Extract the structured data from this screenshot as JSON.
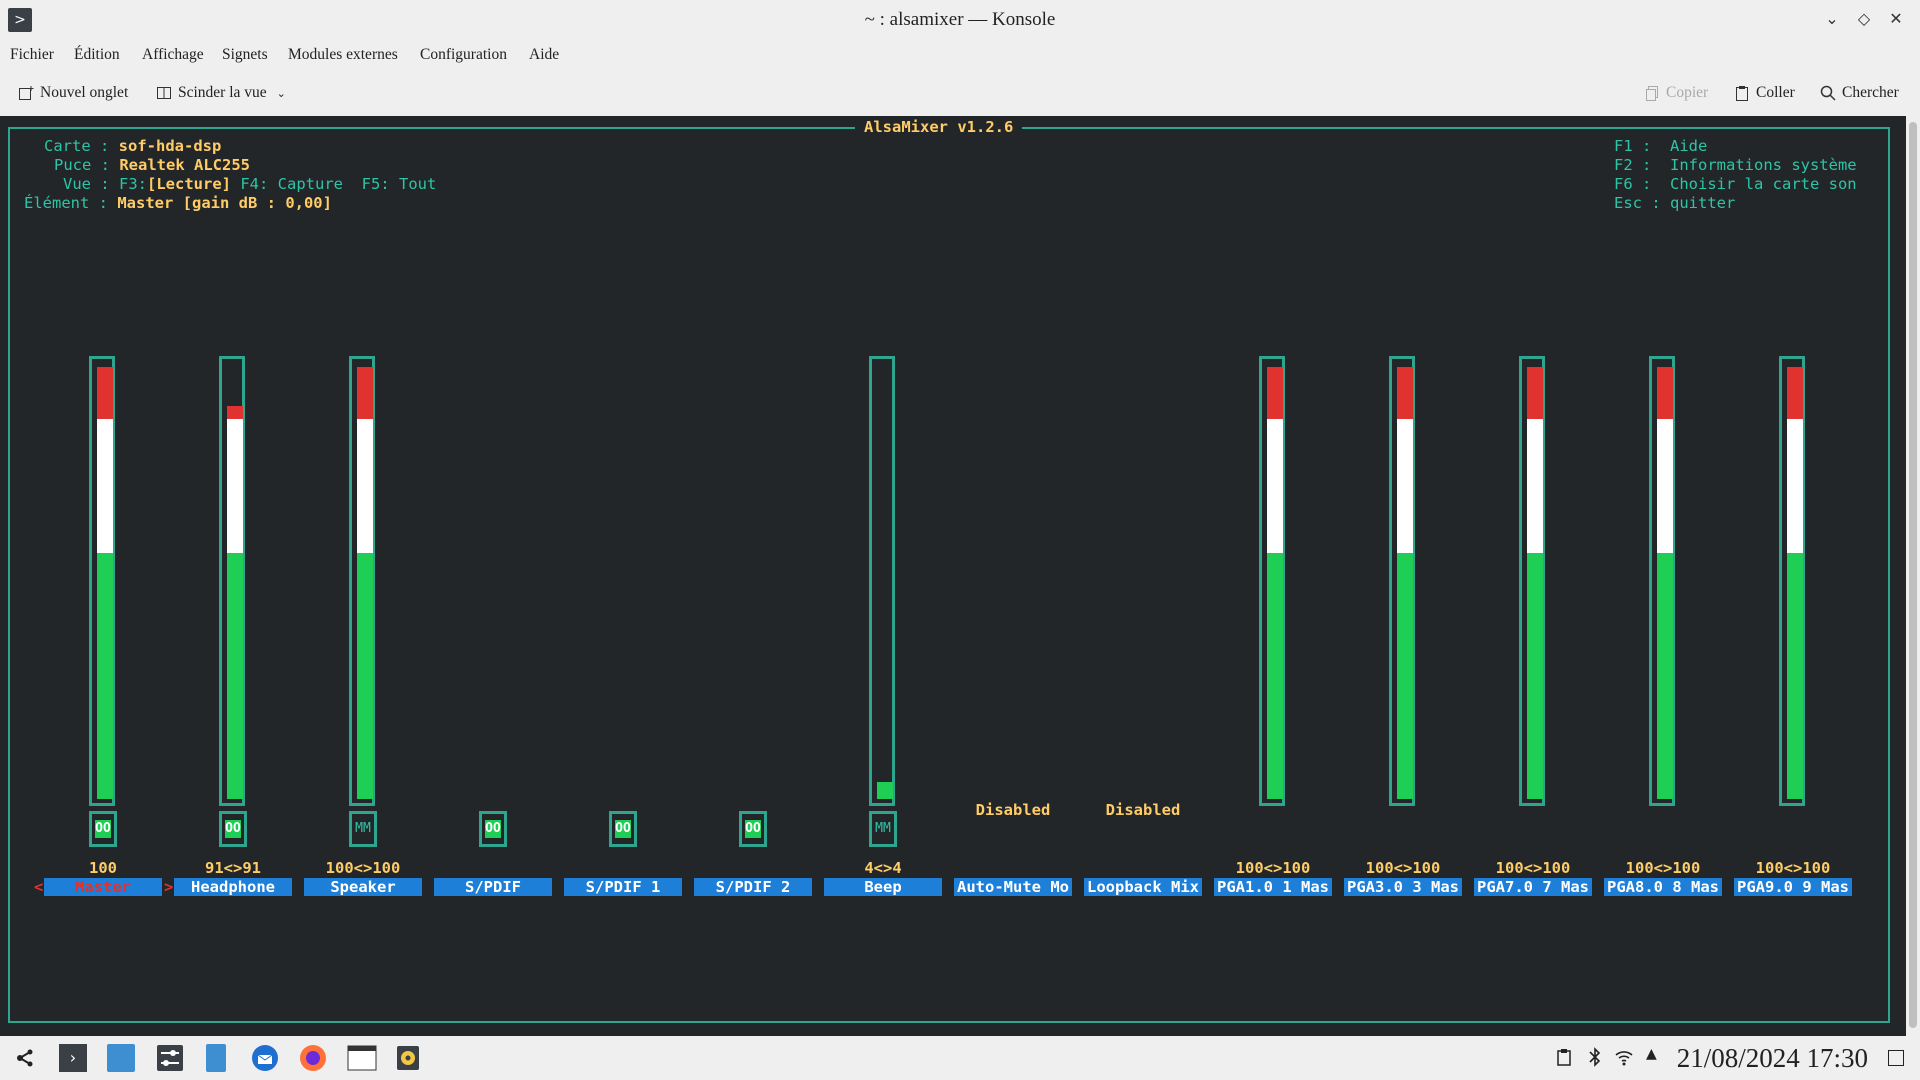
{
  "window": {
    "title": "~ : alsamixer — Konsole",
    "app_icon": ">"
  },
  "window_controls": {
    "minimize": "⌄",
    "maximize": "◇",
    "close": "✕"
  },
  "menu": [
    "Fichier",
    "Édition",
    "Affichage",
    "Signets",
    "Modules externes",
    "Configuration",
    "Aide"
  ],
  "toolbar": {
    "new_tab": "Nouvel onglet",
    "split_view": "Scinder la vue",
    "copy": "Copier",
    "paste": "Coller",
    "search": "Chercher"
  },
  "alsamixer": {
    "title": "AlsaMixer v1.2.6",
    "info": {
      "card_label": "Carte :",
      "card_value": "sof-hda-dsp",
      "chip_label": "Puce :",
      "chip_value": "Realtek ALC255",
      "view_label": "Vue :",
      "view_f3": "F3:",
      "view_f3_value": "[Lecture]",
      "view_rest": " F4: Capture  F5: Tout",
      "element_label": "Élément :",
      "element_value": "Master [gain dB : 0,00]"
    },
    "help": [
      {
        "key": "F1 :",
        "text": "Aide"
      },
      {
        "key": "F2 :",
        "text": "Informations système"
      },
      {
        "key": "F6 :",
        "text": "Choisir la carte son"
      },
      {
        "key": "Esc :",
        "text": "quitter"
      }
    ],
    "channels": [
      {
        "name": "Master",
        "value": "100",
        "level": 1.0,
        "mute": "OO",
        "selected": true
      },
      {
        "name": "Headphone",
        "value": "91<>91",
        "level": 0.91,
        "mute": "OO"
      },
      {
        "name": "Speaker",
        "value": "100<>100",
        "level": 1.0,
        "mute": "MM"
      },
      {
        "name": "S/PDIF",
        "value": "",
        "level": null,
        "mute": "OO"
      },
      {
        "name": "S/PDIF 1",
        "value": "",
        "level": null,
        "mute": "OO"
      },
      {
        "name": "S/PDIF 2",
        "value": "",
        "level": null,
        "mute": "OO"
      },
      {
        "name": "Beep",
        "value": "4<>4",
        "level": 0.04,
        "mute": "MM"
      },
      {
        "name": "Auto-Mute Mo",
        "value": "",
        "level": null,
        "enum": "Disabled"
      },
      {
        "name": "Loopback Mix",
        "value": "",
        "level": null,
        "enum": "Disabled"
      },
      {
        "name": "PGA1.0 1 Mas",
        "value": "100<>100",
        "level": 1.0
      },
      {
        "name": "PGA3.0 3 Mas",
        "value": "100<>100",
        "level": 1.0
      },
      {
        "name": "PGA7.0 7 Mas",
        "value": "100<>100",
        "level": 1.0
      },
      {
        "name": "PGA8.0 8 Mas",
        "value": "100<>100",
        "level": 1.0
      },
      {
        "name": "PGA9.0 9 Mas",
        "value": "100<>100",
        "level": 1.0
      }
    ],
    "selection_markers": {
      "left": "<",
      "right": ">"
    }
  },
  "taskbar": {
    "icons": [
      "app-launcher-icon",
      "konsole-icon",
      "file-manager-icon",
      "system-settings-icon",
      "text-editor-icon",
      "thunderbird-icon",
      "firefox-icon",
      "window-icon",
      "audio-app-icon"
    ],
    "clock": "21/08/2024 17:30"
  }
}
